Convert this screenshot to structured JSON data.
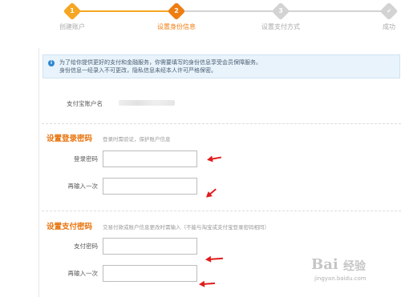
{
  "steps": [
    {
      "num": "1",
      "label": "创建账户"
    },
    {
      "num": "2",
      "label": "设置身份信息"
    },
    {
      "num": "3",
      "label": "设置支付方式"
    },
    {
      "num": "✔",
      "label": "成功"
    }
  ],
  "colors": {
    "step_done": "#f5a623",
    "step_active": "#ef7d0f",
    "step_pending": "#d3d3d3",
    "label_pending": "#aaaaaa",
    "accent": "#e8730c",
    "arrow": "#e21b1b"
  },
  "info": {
    "line1": "为了给你提供更好的支付和金融服务，你需要填写的身份信息享受会员保障服务。",
    "line2": "身份信息一经录入不可更改，隐私信息未经本人许可严格保密。"
  },
  "account": {
    "label": "支付宝账户名"
  },
  "login_password": {
    "title": "设置登录密码",
    "desc": "登录时需验证，保护账户信息",
    "field1_label": "登录密码",
    "field2_label": "再输入一次",
    "field1_value": "",
    "field2_value": ""
  },
  "pay_password": {
    "title": "设置支付密码",
    "desc": "交易付款或账户信息更改时需输入（不能与淘宝或支付宝登录密码相同）",
    "field1_label": "支付密码",
    "field2_label": "再输入一次",
    "field1_value": "",
    "field2_value": ""
  },
  "watermark": {
    "brand": "Bai",
    "text": "经验",
    "url": "jingyan.baidu.com"
  }
}
